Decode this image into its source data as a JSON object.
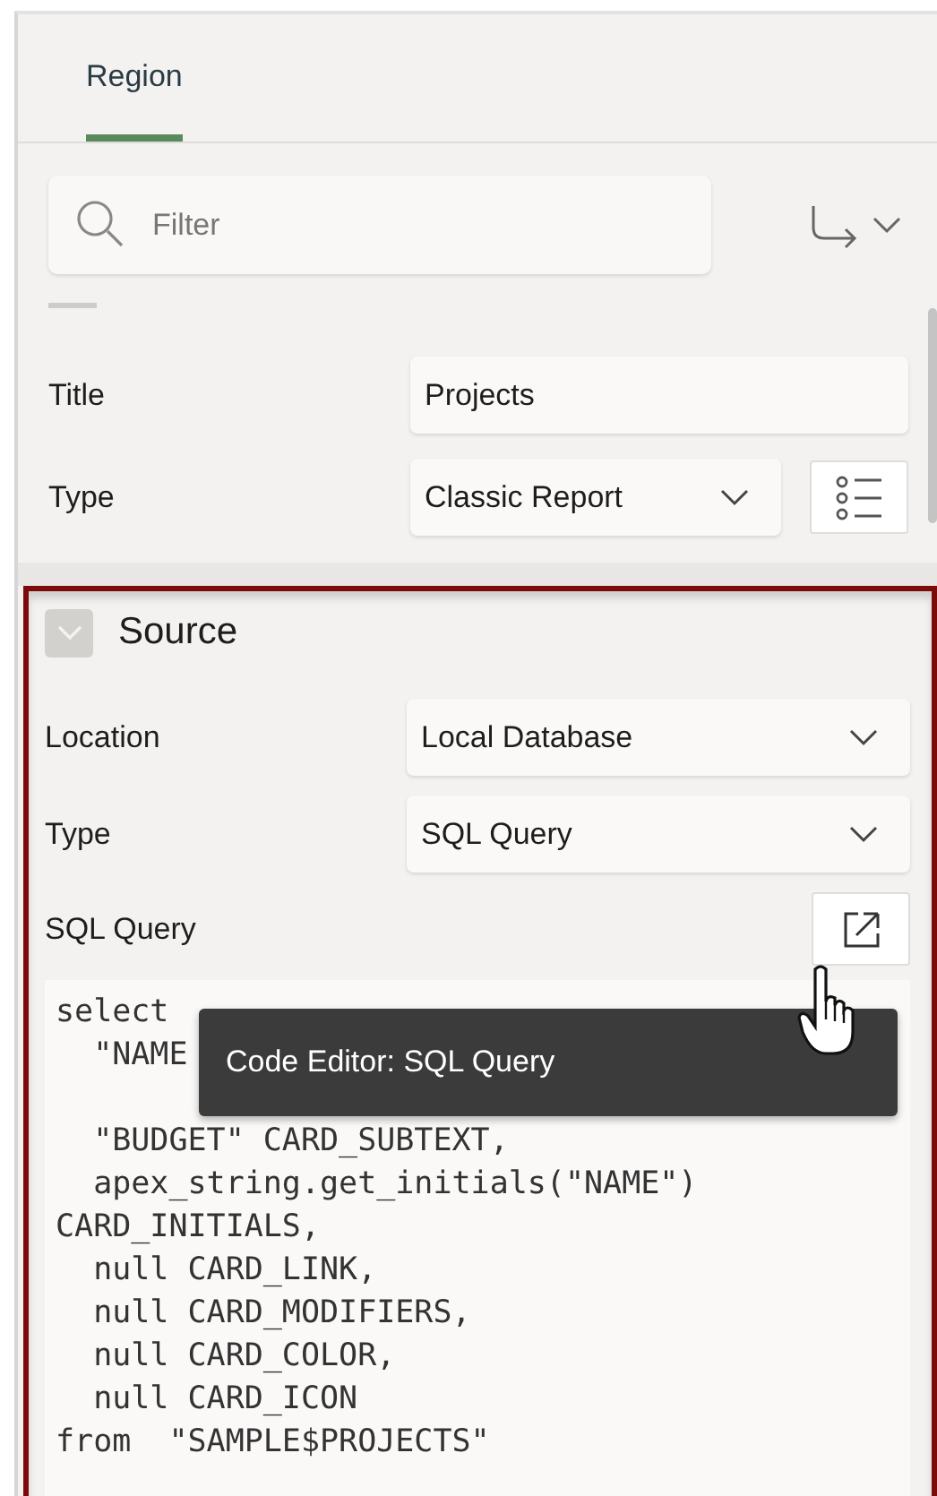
{
  "tabs": [
    {
      "label": "Region",
      "selected": true
    }
  ],
  "filter": {
    "placeholder": "Filter"
  },
  "properties": [
    {
      "label": "Title",
      "kind": "text",
      "value": "Projects"
    },
    {
      "label": "Type",
      "kind": "select-button",
      "value": "Classic Report"
    }
  ],
  "source": {
    "title": "Source",
    "expanded": true,
    "highlighted": true,
    "properties": [
      {
        "label": "Location",
        "kind": "select",
        "value": "Local Database"
      },
      {
        "label": "Type",
        "kind": "select",
        "value": "SQL Query"
      },
      {
        "label": "SQL Query",
        "kind": "button"
      }
    ],
    "code_lines": [
      {
        "text": "select"
      },
      {
        "text": "  \"NAME"
      },
      {
        "covered": true
      },
      {
        "text": "  \"BUDGET\" CARD_SUBTEXT,"
      },
      {
        "text": "  apex_string.get_initials(\"NAME\")"
      },
      {
        "text": "CARD_INITIALS,"
      },
      {
        "text": "  null CARD_LINK,"
      },
      {
        "text": "  null CARD_MODIFIERS,"
      },
      {
        "text": "  null CARD_COLOR,"
      },
      {
        "text": "  null CARD_ICON"
      },
      {
        "text": "from  \"SAMPLE$PROJECTS\""
      }
    ]
  },
  "tooltip": {
    "text": "Code Editor: SQL Query"
  }
}
